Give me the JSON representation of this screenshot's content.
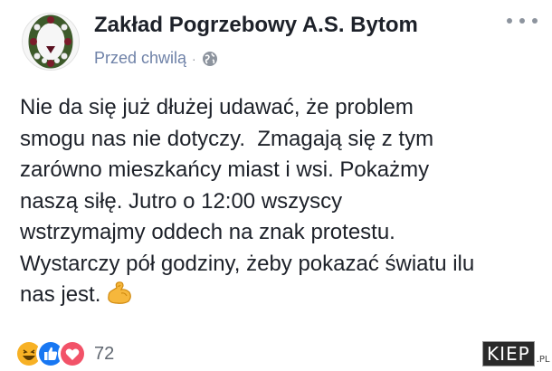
{
  "post": {
    "page_name": "Zakład Pogrzebowy A.S. Bytom",
    "timestamp": "Przed chwilą",
    "privacy_icon": "globe-icon",
    "more_icon": "more-options-icon",
    "text": "Nie da się już dłużej udawać, że problem\nsmogu nas nie dotyczy.  Zmagają się z tym\nzarówno mieszkańcy miast i wsi. Pokażmy\nnaszą siłę. Jutro o 12:00 wszyscy\nwstrzymajmy oddech na znak protestu.\nWystarczy pół godziny, żeby pokazać światu ilu\nnas jest.",
    "emoji": "flexed-biceps-emoji"
  },
  "reactions": {
    "icons": [
      "haha-icon",
      "like-icon",
      "love-icon"
    ],
    "count": "72"
  },
  "watermark": {
    "main": "KIEP",
    "suffix": ".PL"
  },
  "colors": {
    "name": "#1d2129",
    "meta": "#6f82a8",
    "like": "#1877f2",
    "love": "#f25268",
    "haha": "#f7b125"
  }
}
